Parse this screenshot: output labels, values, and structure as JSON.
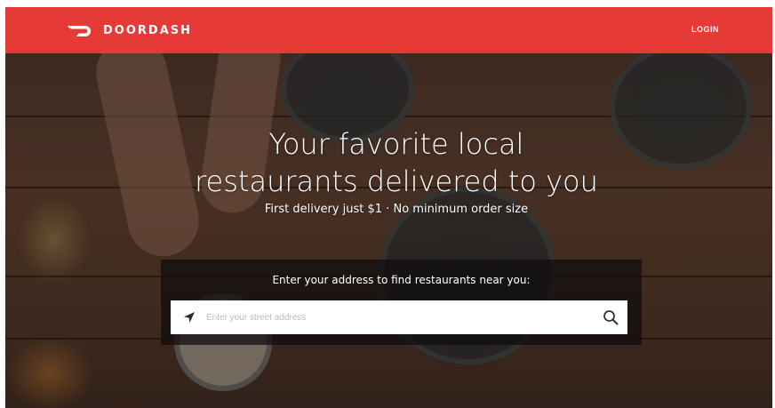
{
  "brand": {
    "name": "DOORDASH",
    "color": "#e63a37"
  },
  "header": {
    "login_label": "LOGIN"
  },
  "hero": {
    "headline_line1": "Your favorite local",
    "headline_line2": "restaurants delivered to you",
    "subline": "First delivery just $1 · No minimum order size"
  },
  "search": {
    "prompt": "Enter your address to find restaurants near you:",
    "placeholder": "Enter your street address",
    "value": "",
    "left_icon": "location-arrow-icon",
    "button_icon": "search-icon"
  }
}
